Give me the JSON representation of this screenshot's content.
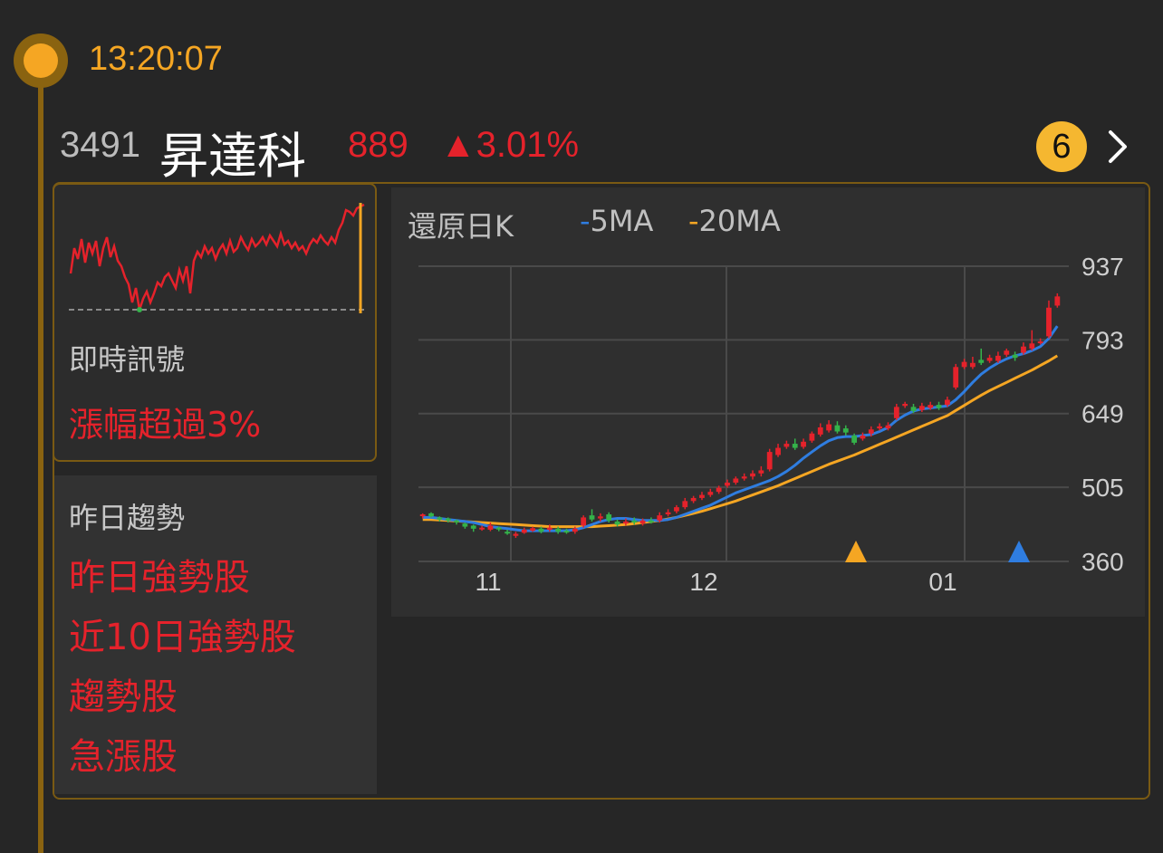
{
  "time": "13:20:07",
  "stock": {
    "code": "3491",
    "name": "昇達科",
    "price": "889",
    "change": "▲3.01%"
  },
  "badge_count": "6",
  "signal": {
    "label": "即時訊號",
    "value": "漲幅超過3%"
  },
  "trend": {
    "label": "昨日趨勢",
    "tags": [
      "昨日強勢股",
      "近10日強勢股",
      "趨勢股",
      "急漲股"
    ]
  },
  "chart": {
    "title": "還原日K",
    "legend_5": "5MA",
    "legend_20": "20MA"
  },
  "colors": {
    "up": "#e5222b",
    "down": "#34b34a",
    "ma5": "#2f7de0",
    "ma20": "#f5a623",
    "accent": "#f5a623"
  },
  "chart_data": {
    "type": "candlestick",
    "y_ticks": [
      937,
      793,
      649,
      505,
      360
    ],
    "ylim": [
      360,
      937
    ],
    "x_tick_labels": [
      "11",
      "12",
      "01"
    ],
    "candles": [
      [
        450,
        452,
        444,
        454
      ],
      [
        454,
        448,
        446,
        456
      ],
      [
        446,
        442,
        438,
        448
      ],
      [
        444,
        440,
        436,
        446
      ],
      [
        440,
        438,
        432,
        442
      ],
      [
        434,
        428,
        424,
        436
      ],
      [
        430,
        424,
        418,
        432
      ],
      [
        424,
        426,
        420,
        430
      ],
      [
        422,
        430,
        419,
        436
      ],
      [
        426,
        424,
        419,
        428
      ],
      [
        418,
        416,
        412,
        422
      ],
      [
        410,
        414,
        406,
        418
      ],
      [
        416,
        422,
        414,
        426
      ],
      [
        420,
        425,
        418,
        428
      ],
      [
        424,
        418,
        415,
        428
      ],
      [
        422,
        426,
        418,
        432
      ],
      [
        424,
        418,
        414,
        428
      ],
      [
        420,
        418,
        414,
        424
      ],
      [
        418,
        424,
        414,
        428
      ],
      [
        430,
        446,
        426,
        450
      ],
      [
        450,
        442,
        438,
        462
      ],
      [
        444,
        448,
        438,
        454
      ],
      [
        452,
        440,
        436,
        456
      ],
      [
        438,
        432,
        428,
        442
      ],
      [
        434,
        438,
        430,
        444
      ],
      [
        440,
        436,
        432,
        446
      ],
      [
        434,
        440,
        430,
        444
      ],
      [
        440,
        438,
        434,
        446
      ],
      [
        440,
        450,
        436,
        456
      ],
      [
        452,
        456,
        448,
        462
      ],
      [
        458,
        466,
        454,
        470
      ],
      [
        466,
        478,
        462,
        484
      ],
      [
        478,
        484,
        474,
        488
      ],
      [
        484,
        490,
        480,
        496
      ],
      [
        490,
        496,
        486,
        502
      ],
      [
        496,
        504,
        492,
        508
      ],
      [
        508,
        514,
        504,
        520
      ],
      [
        514,
        522,
        510,
        526
      ],
      [
        522,
        526,
        518,
        532
      ],
      [
        526,
        532,
        520,
        538
      ],
      [
        532,
        538,
        526,
        546
      ],
      [
        540,
        574,
        536,
        580
      ],
      [
        568,
        582,
        564,
        590
      ],
      [
        584,
        590,
        580,
        596
      ],
      [
        590,
        582,
        578,
        600
      ],
      [
        584,
        594,
        580,
        600
      ],
      [
        596,
        610,
        592,
        614
      ],
      [
        608,
        622,
        604,
        630
      ],
      [
        616,
        628,
        612,
        636
      ],
      [
        626,
        614,
        610,
        634
      ],
      [
        620,
        612,
        606,
        626
      ],
      [
        606,
        592,
        588,
        610
      ],
      [
        600,
        606,
        596,
        612
      ],
      [
        610,
        618,
        604,
        624
      ],
      [
        620,
        624,
        616,
        630
      ],
      [
        620,
        626,
        616,
        632
      ],
      [
        640,
        662,
        636,
        668
      ],
      [
        664,
        668,
        660,
        672
      ],
      [
        662,
        654,
        650,
        668
      ],
      [
        656,
        664,
        652,
        670
      ],
      [
        660,
        666,
        656,
        672
      ],
      [
        666,
        660,
        656,
        672
      ],
      [
        666,
        676,
        662,
        682
      ],
      [
        700,
        740,
        696,
        746
      ],
      [
        740,
        750,
        736,
        756
      ],
      [
        740,
        748,
        736,
        760
      ],
      [
        754,
        748,
        744,
        776
      ],
      [
        752,
        758,
        748,
        764
      ],
      [
        752,
        762,
        748,
        770
      ],
      [
        764,
        772,
        760,
        776
      ],
      [
        764,
        758,
        752,
        770
      ],
      [
        768,
        780,
        764,
        788
      ],
      [
        776,
        786,
        772,
        812
      ],
      [
        790,
        790,
        784,
        796
      ],
      [
        800,
        856,
        796,
        870
      ],
      [
        860,
        878,
        856,
        884
      ]
    ],
    "ma5": [
      446,
      446,
      444,
      442,
      440,
      438,
      436,
      432,
      428,
      426,
      424,
      422,
      420,
      420,
      420,
      420,
      420,
      420,
      422,
      426,
      432,
      438,
      442,
      444,
      444,
      442,
      440,
      440,
      440,
      442,
      446,
      452,
      458,
      464,
      470,
      478,
      486,
      494,
      500,
      506,
      512,
      518,
      526,
      536,
      548,
      562,
      574,
      586,
      596,
      602,
      604,
      604,
      606,
      608,
      614,
      622,
      636,
      646,
      654,
      658,
      660,
      662,
      664,
      676,
      692,
      710,
      726,
      738,
      748,
      756,
      762,
      766,
      772,
      780,
      796,
      820
    ],
    "ma20": [
      442,
      442,
      441,
      440,
      439,
      438,
      437,
      436,
      435,
      434,
      433,
      432,
      431,
      430,
      429,
      428,
      428,
      428,
      428,
      428,
      428,
      429,
      430,
      431,
      432,
      434,
      436,
      438,
      440,
      443,
      446,
      450,
      454,
      458,
      463,
      468,
      473,
      478,
      484,
      490,
      496,
      502,
      508,
      515,
      522,
      529,
      536,
      543,
      550,
      556,
      562,
      568,
      575,
      582,
      589,
      596,
      603,
      610,
      617,
      624,
      631,
      638,
      645,
      655,
      665,
      675,
      685,
      694,
      702,
      710,
      718,
      726,
      734,
      743,
      752,
      762
    ]
  }
}
